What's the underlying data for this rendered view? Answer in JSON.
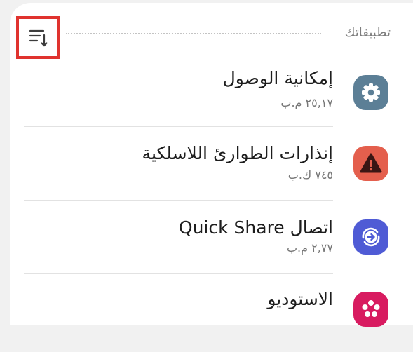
{
  "section": {
    "title": "تطبيقاتك"
  },
  "apps": [
    {
      "name": "إمكانية الوصول",
      "size": "٢٥,١٧ م.ب",
      "icon": "gear-icon",
      "color": "#5c7f96"
    },
    {
      "name": "إنذارات الطوارئ اللاسلكية",
      "size": "٧٤٥ ك.ب",
      "icon": "warning-icon",
      "color": "#e45f4d"
    },
    {
      "name": "اتصال Quick Share",
      "size": "٢,٧٧ م.ب",
      "icon": "quick-share-icon",
      "color": "#4f5bd5"
    },
    {
      "name": "الاستوديو",
      "size": "",
      "icon": "flower-icon",
      "color": "#d81b60"
    }
  ]
}
